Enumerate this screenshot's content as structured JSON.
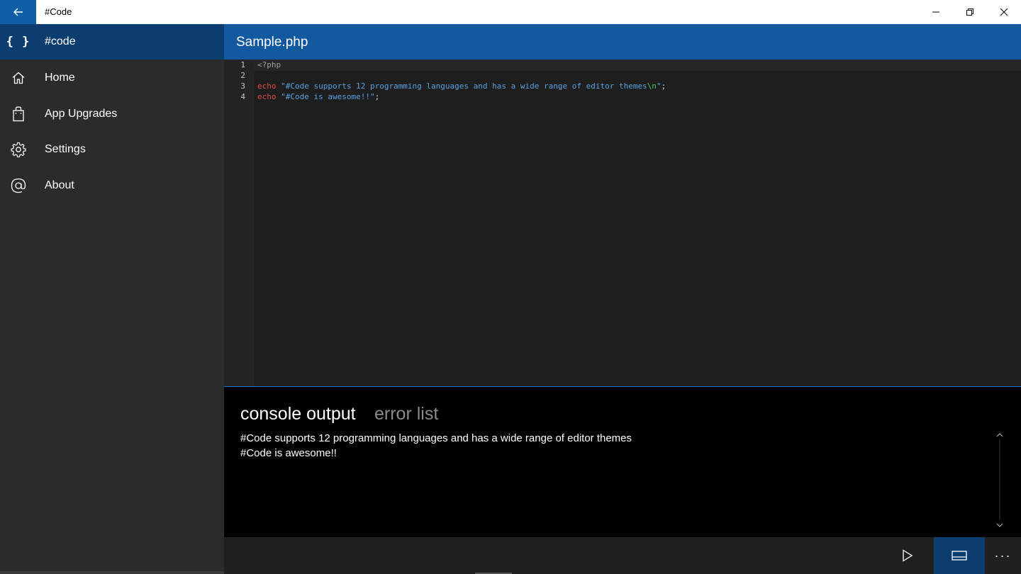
{
  "window": {
    "title": "#Code",
    "minimize_glyph": "—",
    "restore_glyph": "❐",
    "close_glyph": "✕"
  },
  "sidebar": {
    "header": {
      "icon": "braces-icon",
      "glyph": "{ }",
      "label": "#code"
    },
    "items": [
      {
        "icon": "home-icon",
        "label": "Home"
      },
      {
        "icon": "shopping-bag-icon",
        "label": "App Upgrades"
      },
      {
        "icon": "gear-icon",
        "label": "Settings"
      },
      {
        "icon": "at-sign-icon",
        "label": "About"
      }
    ]
  },
  "document": {
    "title": "Sample.php"
  },
  "editor": {
    "line_numbers": [
      "1",
      "2",
      "3",
      "4"
    ],
    "lines": [
      {
        "tokens": [
          {
            "cls": "tag",
            "text": "<?php"
          }
        ]
      },
      {
        "tokens": []
      },
      {
        "tokens": [
          {
            "cls": "kw",
            "text": "echo"
          },
          {
            "cls": "punct",
            "text": " "
          },
          {
            "cls": "str",
            "text": "\"#Code supports 12 programming languages and has a wide range of editor themes"
          },
          {
            "cls": "esc",
            "text": "\\n"
          },
          {
            "cls": "str",
            "text": "\""
          },
          {
            "cls": "punct",
            "text": ";"
          }
        ]
      },
      {
        "tokens": [
          {
            "cls": "kw",
            "text": "echo"
          },
          {
            "cls": "punct",
            "text": " "
          },
          {
            "cls": "str",
            "text": "\"#Code is awesome!!\""
          },
          {
            "cls": "punct",
            "text": ";"
          }
        ]
      }
    ]
  },
  "console": {
    "tabs": [
      {
        "label": "console output",
        "active": true
      },
      {
        "label": "error list",
        "active": false
      }
    ],
    "output": [
      "#Code supports 12 programming languages and has a wide range of editor themes",
      "#Code is awesome!!"
    ]
  },
  "command_bar": {
    "run_icon": "play-icon",
    "panel_icon": "panel-toggle-icon",
    "more_glyph": "···"
  },
  "colors": {
    "accent": "#0f5fa8",
    "header_blue": "#1359a0",
    "sidebar_active": "#0b3d6e",
    "sidebar_bg": "#2b2b2b",
    "editor_bg": "#1e1e1e",
    "keyword": "#e04848",
    "string": "#5aa0e0",
    "escape": "#4ec96b"
  }
}
